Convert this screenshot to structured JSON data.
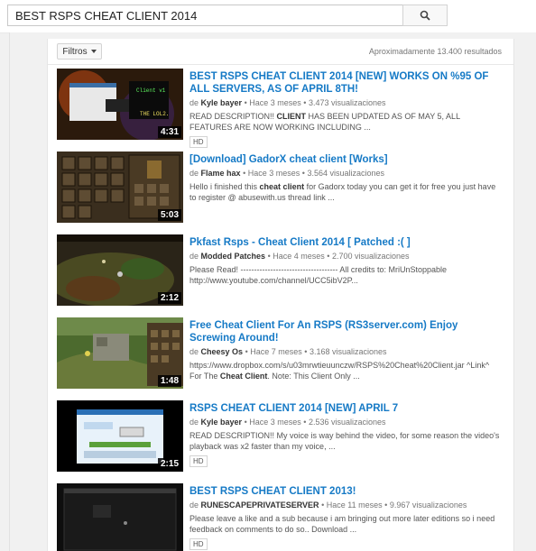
{
  "search": {
    "query": "BEST RSPS CHEAT CLIENT 2014",
    "button_icon": "search-icon"
  },
  "toolbar": {
    "filter_label": "Filtros",
    "result_count": "Aproximadamente 13.400 resultados"
  },
  "meta_labels": {
    "by": "de",
    "sep": "•"
  },
  "results": [
    {
      "title": "BEST RSPS CHEAT CLIENT 2014 [NEW] WORKS ON %95 OF ALL SERVERS, AS OF APRIL 8TH!",
      "channel": "Kyle bayer",
      "age": "Hace 3 meses",
      "views": "3.473 visualizaciones",
      "desc_pre": "READ DESCRIPTION!! ",
      "desc_bold": "CLIENT",
      "desc_post": " HAS BEEN UPDATED AS OF MAY 5, ALL FEATURES ARE NOW WORKING INCLUDING ...",
      "duration": "4:31",
      "badge": "HD"
    },
    {
      "title": "[Download] GadorX cheat client [Works]",
      "channel": "Flame hax",
      "age": "Hace 3 meses",
      "views": "3.564 visualizaciones",
      "desc_pre": "Hello i finished this ",
      "desc_bold": "cheat client",
      "desc_post": " for Gadorx today you can get it for free you just have to register @ abusewith.us thread link ...",
      "duration": "5:03",
      "badge": ""
    },
    {
      "title": "Pkfast Rsps - Cheat Client 2014 [ Patched :( ]",
      "channel": "Modded Patches",
      "age": "Hace 4 meses",
      "views": "2.700 visualizaciones",
      "desc_pre": "Please Read! ------------------------------------ All credits to: MriUnStoppable http://www.youtube.com/channel/UCC5ibV2P...",
      "desc_bold": "",
      "desc_post": "",
      "duration": "2:12",
      "badge": ""
    },
    {
      "title": "Free Cheat Client For An RSPS (RS3server.com) Enjoy Screwing Around!",
      "channel": "Cheesy Os",
      "age": "Hace 7 meses",
      "views": "3.168 visualizaciones",
      "desc_pre": "https://www.dropbox.com/s/u03mrwtieuunczw/RSPS%20Cheat%20Client.jar ^Link^ For The ",
      "desc_bold": "Cheat Client",
      "desc_post": ". Note: This Client Only ...",
      "duration": "1:48",
      "badge": ""
    },
    {
      "title": "RSPS CHEAT CLIENT 2014 [NEW] APRIL 7",
      "channel": "Kyle bayer",
      "age": "Hace 3 meses",
      "views": "2.536 visualizaciones",
      "desc_pre": "READ DESCRIPTION!! My voice is way behind the video, for some reason the video's playback was x2 faster than my voice, ...",
      "desc_bold": "",
      "desc_post": "",
      "duration": "2:15",
      "badge": "HD"
    },
    {
      "title": "BEST RSPS CHEAT CLIENT 2013!",
      "channel": "RUNESCAPEPRIVATESERVER",
      "age": "Hace 11 meses",
      "views": "9.967 visualizaciones",
      "desc_pre": "Please leave a like and a sub because i am bringing out more later editions so i need feedback on comments to do so.. Download ...",
      "desc_bold": "",
      "desc_post": "",
      "duration": "",
      "badge": "HD"
    }
  ]
}
